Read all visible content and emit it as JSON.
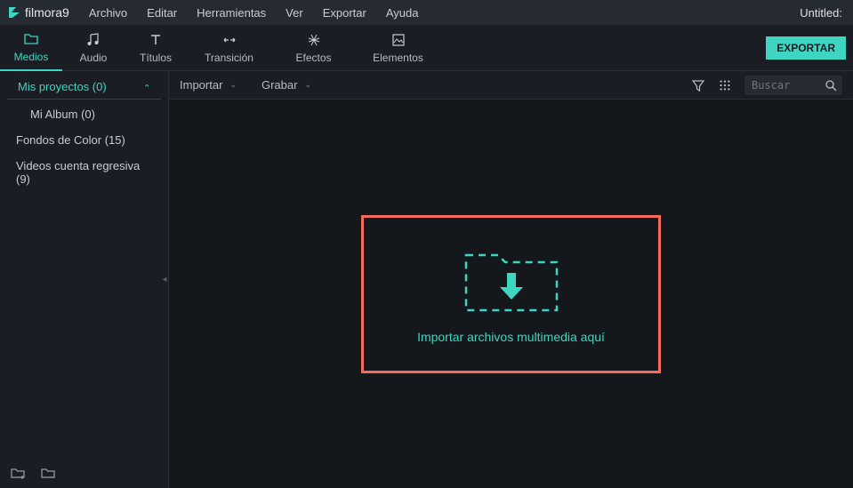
{
  "app": {
    "name": "filmora",
    "version": "9"
  },
  "menubar": {
    "items": [
      "Archivo",
      "Editar",
      "Herramientas",
      "Ver",
      "Exportar",
      "Ayuda"
    ],
    "title": "Untitled:"
  },
  "toolbar": {
    "tabs": [
      {
        "label": "Medios",
        "active": true
      },
      {
        "label": "Audio",
        "active": false
      },
      {
        "label": "Títulos",
        "active": false
      },
      {
        "label": "Transición",
        "active": false
      },
      {
        "label": "Efectos",
        "active": false
      },
      {
        "label": "Elementos",
        "active": false
      }
    ],
    "export_label": "EXPORTAR"
  },
  "sidebar": {
    "header": "Mis proyectos (0)",
    "items": [
      {
        "label": "Mi Album (0)",
        "child": true
      },
      {
        "label": "Fondos de Color (15)",
        "child": false
      },
      {
        "label": "Videos cuenta regresiva (9)",
        "child": false
      }
    ]
  },
  "content_toolbar": {
    "import_label": "Importar",
    "record_label": "Grabar",
    "search_placeholder": "Buscar"
  },
  "drop_zone": {
    "text": "Importar archivos multimedia aquí"
  },
  "colors": {
    "accent": "#3ed6c0",
    "highlight_border": "#f56a5a"
  }
}
